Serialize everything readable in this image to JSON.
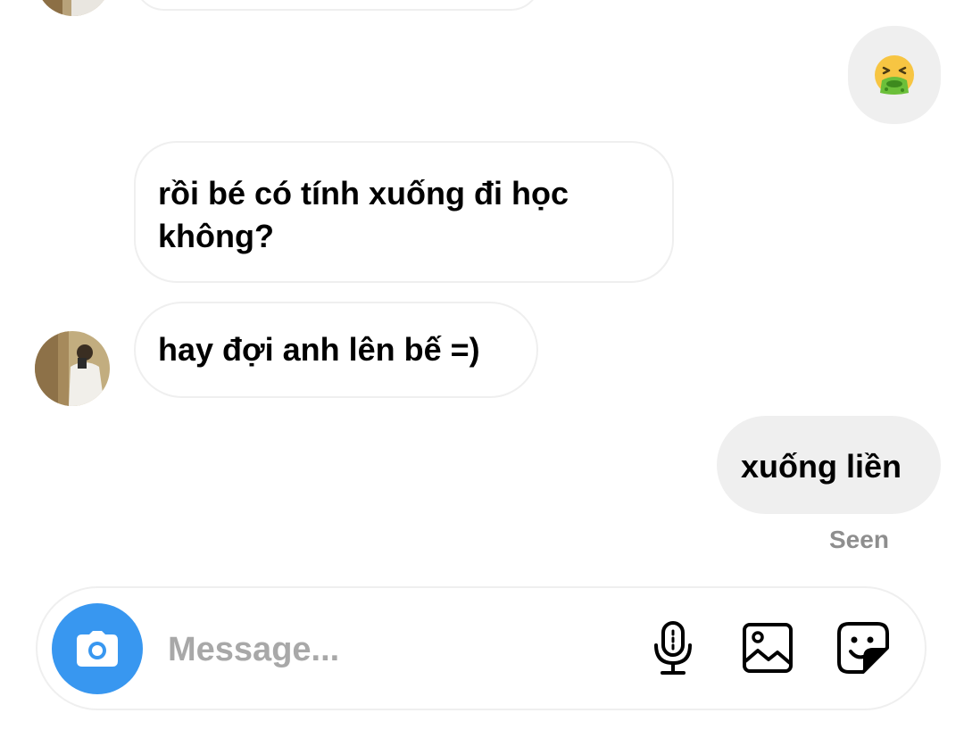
{
  "conversation": {
    "messages": [
      {
        "direction": "outgoing",
        "type": "emoji",
        "icon": "nauseated-face-emoji"
      },
      {
        "direction": "incoming",
        "text": "rồi bé có tính xuống đi học không?"
      },
      {
        "direction": "incoming",
        "text": "hay đợi anh lên bế =)"
      },
      {
        "direction": "outgoing",
        "text": "xuống liền"
      }
    ],
    "status": "Seen"
  },
  "composer": {
    "placeholder": "Message...",
    "camera_icon": "camera-icon",
    "mic_icon": "microphone-icon",
    "gallery_icon": "gallery-icon",
    "sticker_icon": "sticker-icon",
    "accent_color": "#3897f0"
  }
}
